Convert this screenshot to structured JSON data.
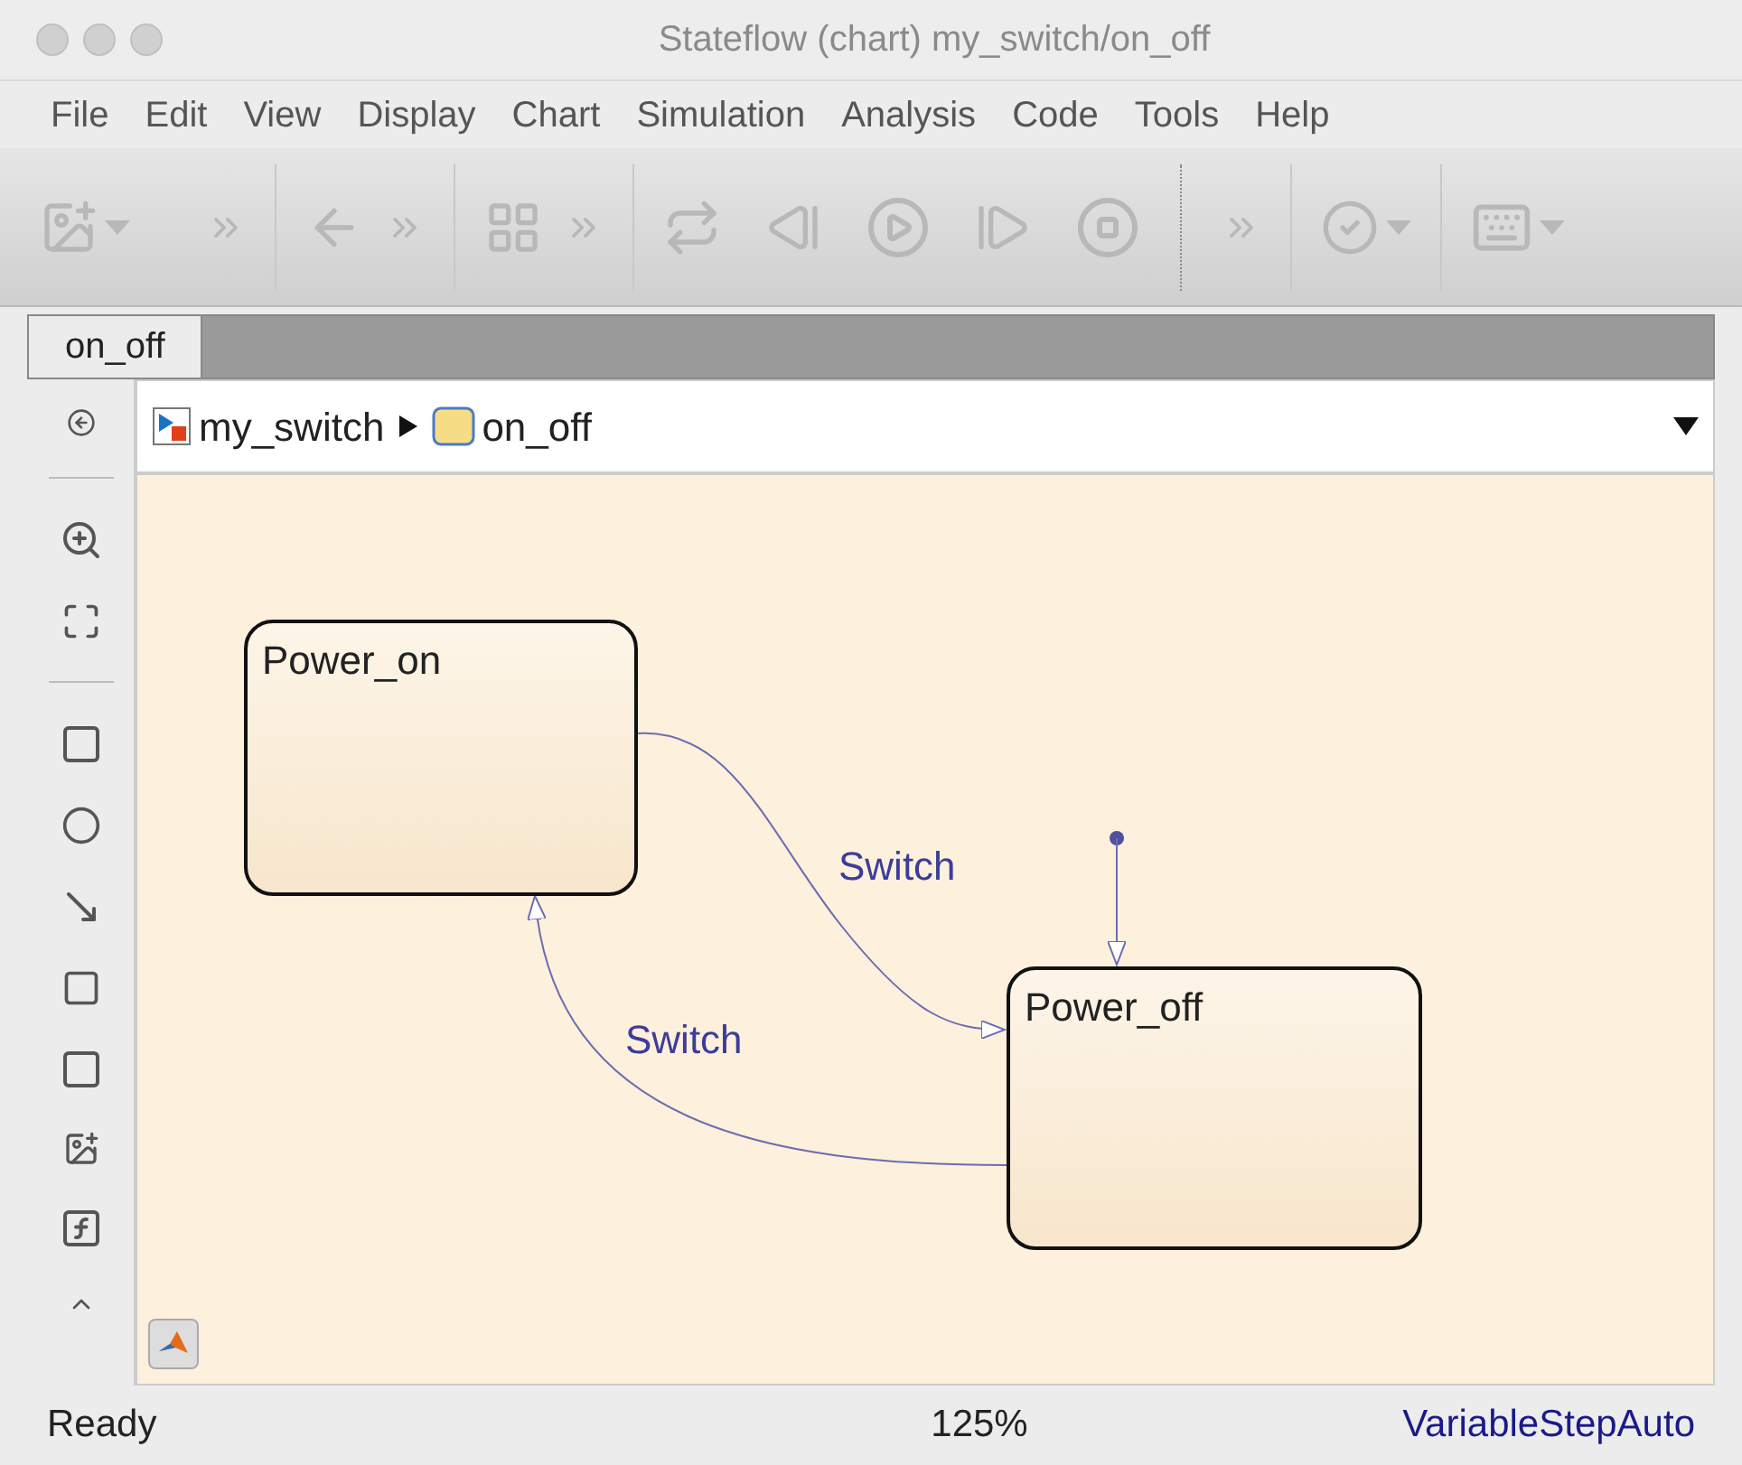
{
  "window": {
    "title": "Stateflow (chart) my_switch/on_off"
  },
  "menu": [
    "File",
    "Edit",
    "View",
    "Display",
    "Chart",
    "Simulation",
    "Analysis",
    "Code",
    "Tools",
    "Help"
  ],
  "tabs": [
    {
      "label": "on_off",
      "selected": true
    }
  ],
  "breadcrumb": [
    {
      "kind": "model",
      "label": "my_switch"
    },
    {
      "kind": "chart",
      "label": "on_off"
    }
  ],
  "states": [
    {
      "name": "Power_on"
    },
    {
      "name": "Power_off"
    }
  ],
  "transitions": [
    {
      "label": "Switch"
    },
    {
      "label": "Switch"
    }
  ],
  "status_bar": {
    "status": "Ready",
    "zoom": "125%",
    "solver": "VariableStepAuto"
  }
}
